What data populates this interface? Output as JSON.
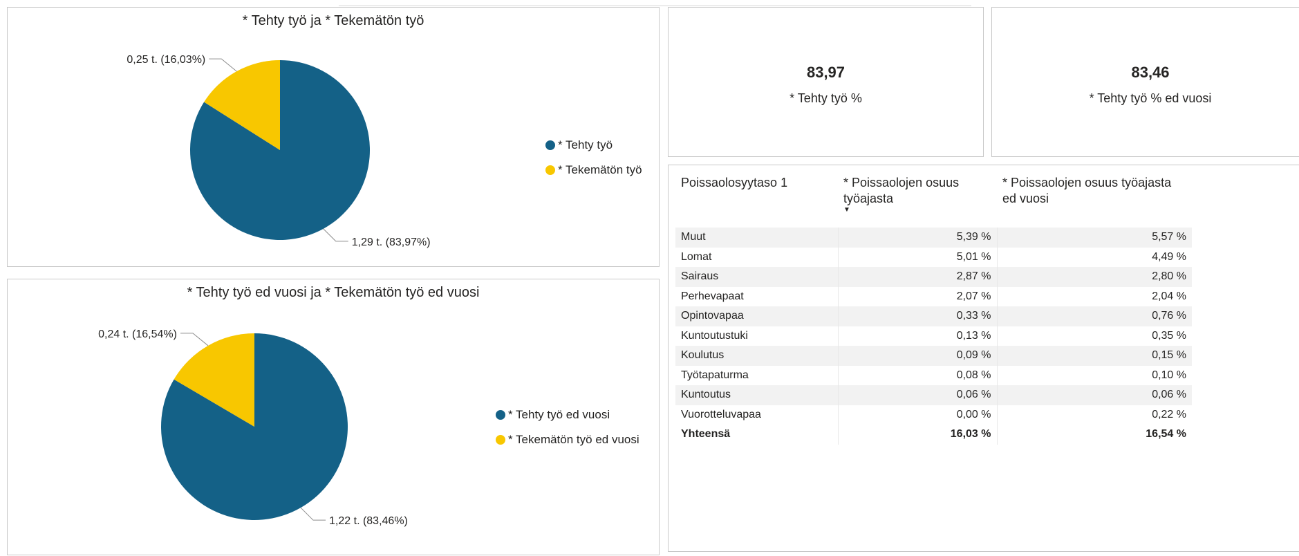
{
  "colors": {
    "tehty": "#146187",
    "tekematon": "#f8c700"
  },
  "chart_data": [
    {
      "type": "pie",
      "title": "* Tehty työ ja * Tekemätön työ",
      "slices": [
        {
          "name": "* Tehty työ",
          "value": 1.29,
          "percent": 83.97,
          "label": "1,29 t. (83,97%)"
        },
        {
          "name": "* Tekemätön työ",
          "value": 0.25,
          "percent": 16.03,
          "label": "0,25 t. (16,03%)"
        }
      ],
      "legend": "right"
    },
    {
      "type": "pie",
      "title": "* Tehty työ ed vuosi ja * Tekemätön työ ed vuosi",
      "slices": [
        {
          "name": "* Tehty työ ed vuosi",
          "value": 1.22,
          "percent": 83.46,
          "label": "1,22 t. (83,46%)"
        },
        {
          "name": "* Tekemätön työ ed vuosi",
          "value": 0.24,
          "percent": 16.54,
          "label": "0,24 t. (16,54%)"
        }
      ],
      "legend": "right"
    },
    {
      "type": "table",
      "columns": [
        "Poissaolosyytaso 1",
        "* Poissaolojen osuus työajasta",
        "* Poissaolojen osuus työajasta ed vuosi"
      ],
      "rows": [
        [
          "Muut",
          "5,39 %",
          "5,57 %"
        ],
        [
          "Lomat",
          "5,01 %",
          "4,49 %"
        ],
        [
          "Sairaus",
          "2,87 %",
          "2,80 %"
        ],
        [
          "Perhevapaat",
          "2,07 %",
          "2,04 %"
        ],
        [
          "Opintovapaa",
          "0,33 %",
          "0,76 %"
        ],
        [
          "Kuntoutustuki",
          "0,13 %",
          "0,35 %"
        ],
        [
          "Koulutus",
          "0,09 %",
          "0,15 %"
        ],
        [
          "Työtapaturma",
          "0,08 %",
          "0,10 %"
        ],
        [
          "Kuntoutus",
          "0,06 %",
          "0,06 %"
        ],
        [
          "Vuorotteluvapaa",
          "0,00 %",
          "0,22 %"
        ]
      ],
      "total": [
        "Yhteensä",
        "16,03 %",
        "16,54 %"
      ]
    }
  ],
  "cards": [
    {
      "value": "83,97",
      "label": "* Tehty työ %"
    },
    {
      "value": "83,46",
      "label": "* Tehty työ % ed vuosi"
    }
  ]
}
